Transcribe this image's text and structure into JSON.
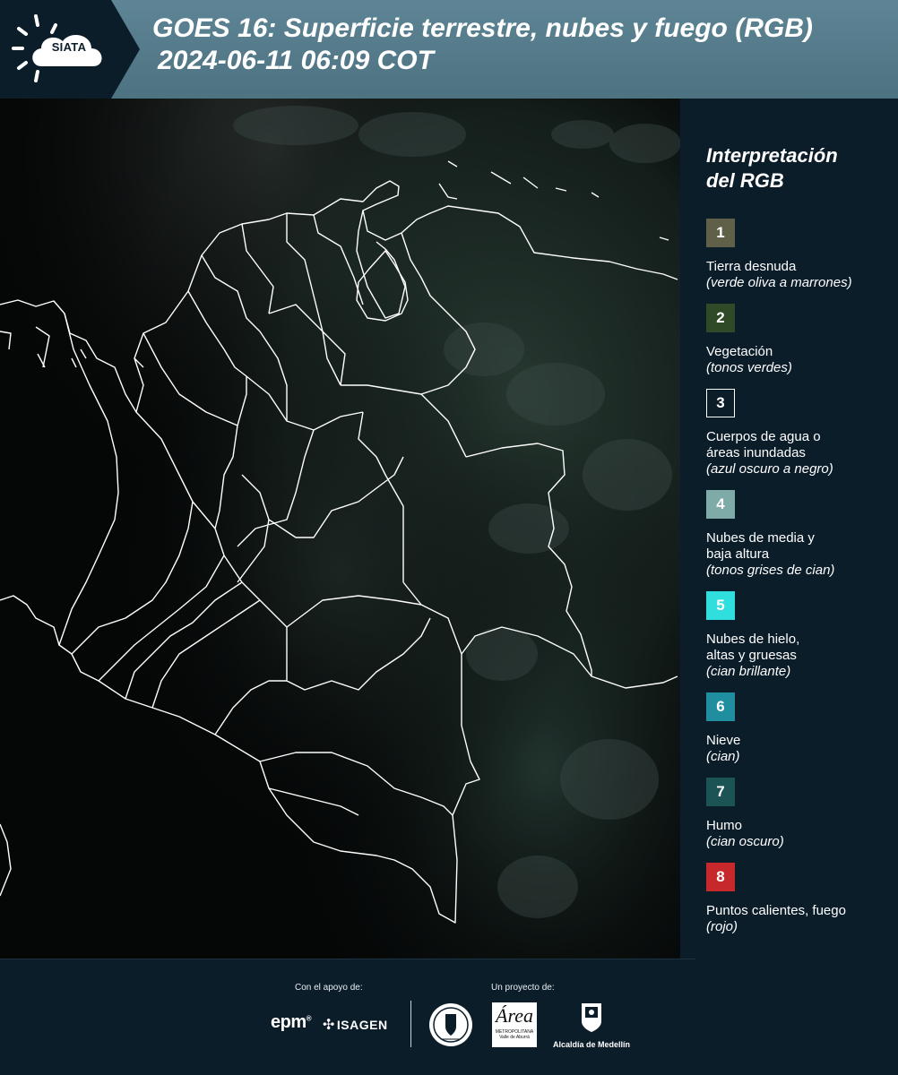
{
  "header": {
    "logo_text": "SIATA",
    "title_line1": "GOES 16: Superficie terrestre, nubes y fuego (RGB)",
    "title_line2": "2024-06-11 06:09 COT"
  },
  "legend": {
    "title_line1": "Interpretación",
    "title_line2": "del RGB",
    "items": [
      {
        "number": "1",
        "label_line1": "Tierra desnuda",
        "label_line2": "",
        "note": "(verde oliva a marrones)",
        "color": "#5f6047"
      },
      {
        "number": "2",
        "label_line1": "Vegetación",
        "label_line2": "",
        "note": "(tonos verdes)",
        "color": "#2f4a26"
      },
      {
        "number": "3",
        "label_line1": "Cuerpos de agua o",
        "label_line2": "áreas inundadas",
        "note": "(azul oscuro a negro)",
        "color": "#0c1d2a"
      },
      {
        "number": "4",
        "label_line1": "Nubes de media y",
        "label_line2": "baja altura",
        "note": "(tonos grises de cian)",
        "color": "#7eaaa8"
      },
      {
        "number": "5",
        "label_line1": "Nubes de hielo,",
        "label_line2": "altas y gruesas",
        "note": "(cian brillante)",
        "color": "#30dedd"
      },
      {
        "number": "6",
        "label_line1": "Nieve",
        "label_line2": "",
        "note": "(cian)",
        "color": "#1f8fa0"
      },
      {
        "number": "7",
        "label_line1": "Humo",
        "label_line2": "",
        "note": "(cian oscuro)",
        "color": "#1c5355"
      },
      {
        "number": "8",
        "label_line1": "Puntos calientes, fuego",
        "label_line2": "",
        "note": "(rojo)",
        "color": "#c6282c"
      }
    ]
  },
  "footer": {
    "support_label": "Con el apoyo de:",
    "project_label": "Un proyecto de:",
    "epm": "epm",
    "isagen": "ISAGEN",
    "area_name": "Área",
    "area_sub1": "METROPOLITANA",
    "area_sub2": "Valle de Aburrá",
    "alcaldia": "Alcaldía de Medellín"
  }
}
